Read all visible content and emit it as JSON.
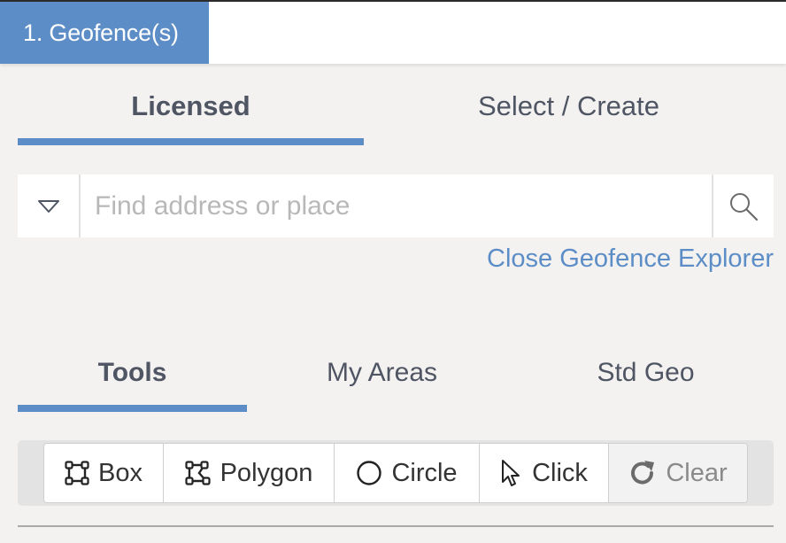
{
  "header": {
    "tab_label": "1. Geofence(s)"
  },
  "primary_tabs": [
    {
      "label": "Licensed",
      "active": true
    },
    {
      "label": "Select / Create",
      "active": false
    }
  ],
  "search": {
    "placeholder": "Find address or place",
    "value": "",
    "dropdown_icon": "triangle-down-icon",
    "search_icon": "magnifier-icon"
  },
  "close_link": "Close Geofence Explorer",
  "secondary_tabs": [
    {
      "label": "Tools",
      "active": true
    },
    {
      "label": "My Areas",
      "active": false
    },
    {
      "label": "Std Geo",
      "active": false
    }
  ],
  "tools": [
    {
      "label": "Box",
      "icon": "box-icon"
    },
    {
      "label": "Polygon",
      "icon": "polygon-icon"
    },
    {
      "label": "Circle",
      "icon": "circle-icon"
    },
    {
      "label": "Click",
      "icon": "cursor-icon"
    },
    {
      "label": "Clear",
      "icon": "redo-icon",
      "disabled": true
    }
  ],
  "colors": {
    "accent": "#5d8dc6",
    "background": "#f3f2f1",
    "text": "#4f5563"
  }
}
